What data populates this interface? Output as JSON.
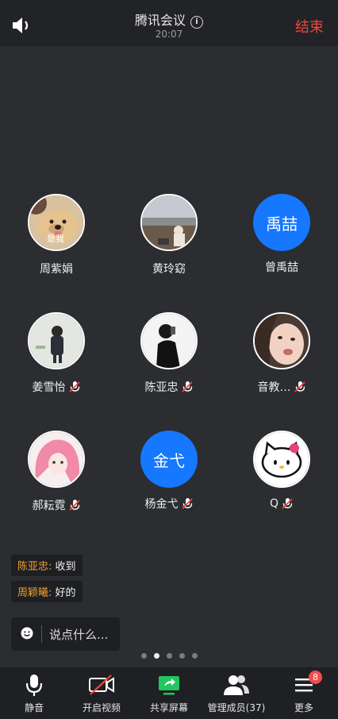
{
  "header": {
    "title": "腾讯会议",
    "time": "20:07",
    "end_label": "结束"
  },
  "participants": [
    {
      "name": "周紫娟",
      "avatar_label": "是我"
    },
    {
      "name": "黄玲窈"
    },
    {
      "name": "曾禹喆",
      "avatar_text": "禹喆"
    },
    {
      "name": "姜雪怡",
      "muted": true
    },
    {
      "name": "陈亚忠",
      "muted": true
    },
    {
      "name": "音教…",
      "muted": true
    },
    {
      "name": "郝耘霓",
      "muted": true
    },
    {
      "name": "杨金弋",
      "avatar_text": "金弋",
      "muted": true
    },
    {
      "name": "Q",
      "muted": true
    }
  ],
  "chat": [
    {
      "sender": "陈亚忠:",
      "message": " 收到"
    },
    {
      "sender": "周颖曦:",
      "message": " 好的"
    }
  ],
  "input": {
    "placeholder": "说点什么..."
  },
  "pager": {
    "total": 5,
    "active_index": 1
  },
  "toolbar": {
    "mute": "静音",
    "video": "开启视频",
    "share": "共享屏幕",
    "members": "管理成员(37)",
    "more": "更多",
    "more_badge": "8"
  },
  "colors": {
    "accent_blue": "#1677ff",
    "end_red": "#f0463c",
    "sender_orange": "#f0a030",
    "share_green": "#22c55e"
  }
}
